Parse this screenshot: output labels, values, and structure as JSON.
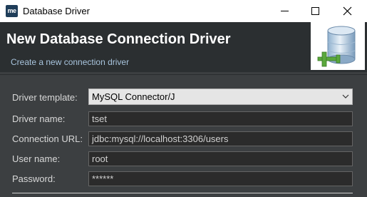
{
  "window": {
    "app_icon": "me",
    "title": "Database Driver",
    "controls": [
      "minimize-icon",
      "maximize-icon",
      "close-icon"
    ]
  },
  "header": {
    "title": "New Database Connection Driver",
    "subtitle": "Create a new connection driver",
    "banner_icon": "database-connection-icon"
  },
  "form": {
    "driver_template": {
      "label": "Driver template:",
      "value": "MySQL Connector/J"
    },
    "driver_name": {
      "label": "Driver name:",
      "value": "tset"
    },
    "connection_url": {
      "label": "Connection URL:",
      "value": "jdbc:mysql://localhost:3306/users"
    },
    "user_name": {
      "label": "User name:",
      "value": "root"
    },
    "password": {
      "label": "Password:",
      "value": "******"
    }
  },
  "colors": {
    "header_bg": "#2b2f31",
    "form_bg": "#3c3f41",
    "subtitle": "#a8c4dd",
    "field_bg": "#2b2b2b",
    "field_border": "#646464"
  }
}
